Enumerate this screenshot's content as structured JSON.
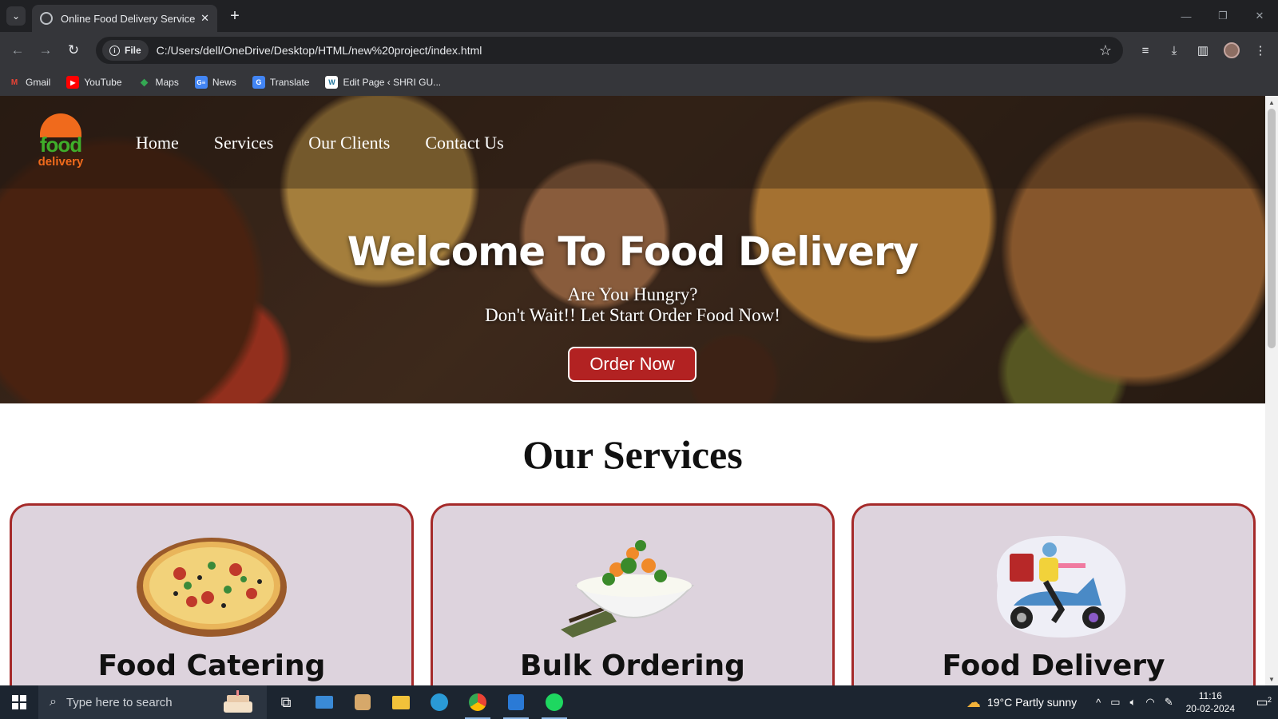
{
  "browser": {
    "tab_title": "Online Food Delivery Service",
    "tab_close": "✕",
    "new_tab": "+",
    "address_chip": "File",
    "url": "C:/Users/dell/OneDrive/Desktop/HTML/new%20project/index.html",
    "bookmarks": [
      {
        "label": "Gmail",
        "icon": "gmail-icon",
        "color": "#ea4335"
      },
      {
        "label": "YouTube",
        "icon": "youtube-icon",
        "color": "#ff0000"
      },
      {
        "label": "Maps",
        "icon": "maps-icon",
        "color": "#34a853"
      },
      {
        "label": "News",
        "icon": "news-icon",
        "color": "#4285f4"
      },
      {
        "label": "Translate",
        "icon": "translate-icon",
        "color": "#4285f4"
      },
      {
        "label": "Edit Page ‹ SHRI GU...",
        "icon": "wordpress-icon",
        "color": "#ffffff"
      }
    ]
  },
  "site": {
    "logo": {
      "line1": "food",
      "line2": "delivery"
    },
    "nav": [
      "Home",
      "Services",
      "Our Clients",
      "Contact Us"
    ],
    "hero": {
      "title": "Welcome To Food Delivery",
      "subtitle1": "Are You Hungry?",
      "subtitle2": "Don't Wait!! Let Start Order Food Now!",
      "cta": "Order Now"
    },
    "services_title": "Our Services",
    "services": [
      {
        "title": "Food Catering",
        "icon": "pizza-icon"
      },
      {
        "title": "Bulk Ordering",
        "icon": "rice-bowl-icon"
      },
      {
        "title": "Food Delivery",
        "icon": "scooter-rider-icon"
      }
    ],
    "colors": {
      "accent": "#b22222",
      "card_bg": "#ddd3dd",
      "card_border": "#a52a2a"
    }
  },
  "taskbar": {
    "search_placeholder": "Type here to search",
    "weather": "19°C  Partly sunny",
    "time": "11:16",
    "date": "20-02-2024",
    "notifications": "2"
  }
}
